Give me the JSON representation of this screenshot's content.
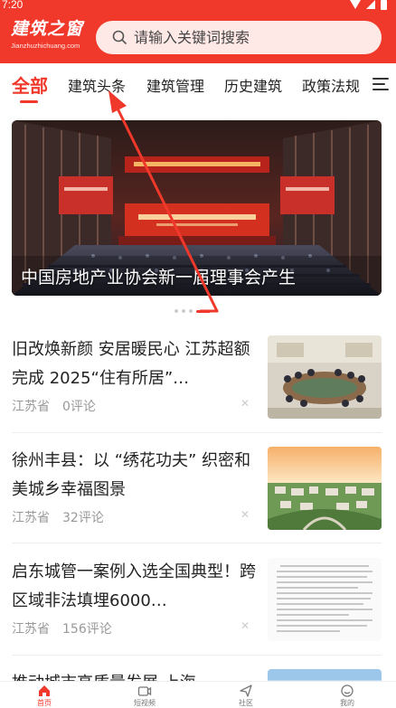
{
  "status_bar": {
    "time": "7:20"
  },
  "header": {
    "logo_text": "建筑之窗",
    "logo_subtext": "Jianzhuzhichuang.com",
    "search_placeholder": "请输入关键词搜索"
  },
  "tabs": [
    "全部",
    "建筑头条",
    "建筑管理",
    "历史建筑",
    "政策法规"
  ],
  "active_tab": 0,
  "banner": {
    "caption": "中国房地产业协会新一届理事会产生",
    "slide_count": 4,
    "active_slide": 3
  },
  "news": [
    {
      "title": "旧改焕新颜 安居暖民心 江苏超额完成 2025“住有所居”…",
      "source": "江苏省",
      "comments": "0评论"
    },
    {
      "title": "徐州丰县：以 “绣花功夫” 织密和美城乡幸福图景",
      "source": "江苏省",
      "comments": "32评论"
    },
    {
      "title": "启东城管一案例入选全国典型！跨区域非法填埋6000…",
      "source": "江苏省",
      "comments": "156评论"
    },
    {
      "title": "推动城市高质量发展 上海",
      "source": "",
      "comments": ""
    }
  ],
  "bottom_nav": [
    {
      "label": "首页",
      "icon": "home-icon"
    },
    {
      "label": "短视频",
      "icon": "video-icon"
    },
    {
      "label": "社区",
      "icon": "send-icon"
    },
    {
      "label": "我的",
      "icon": "profile-icon"
    }
  ],
  "colors": {
    "brand": "#f0392b",
    "search_bg": "#ffe9e6",
    "text": "#222222",
    "meta": "#999999"
  }
}
